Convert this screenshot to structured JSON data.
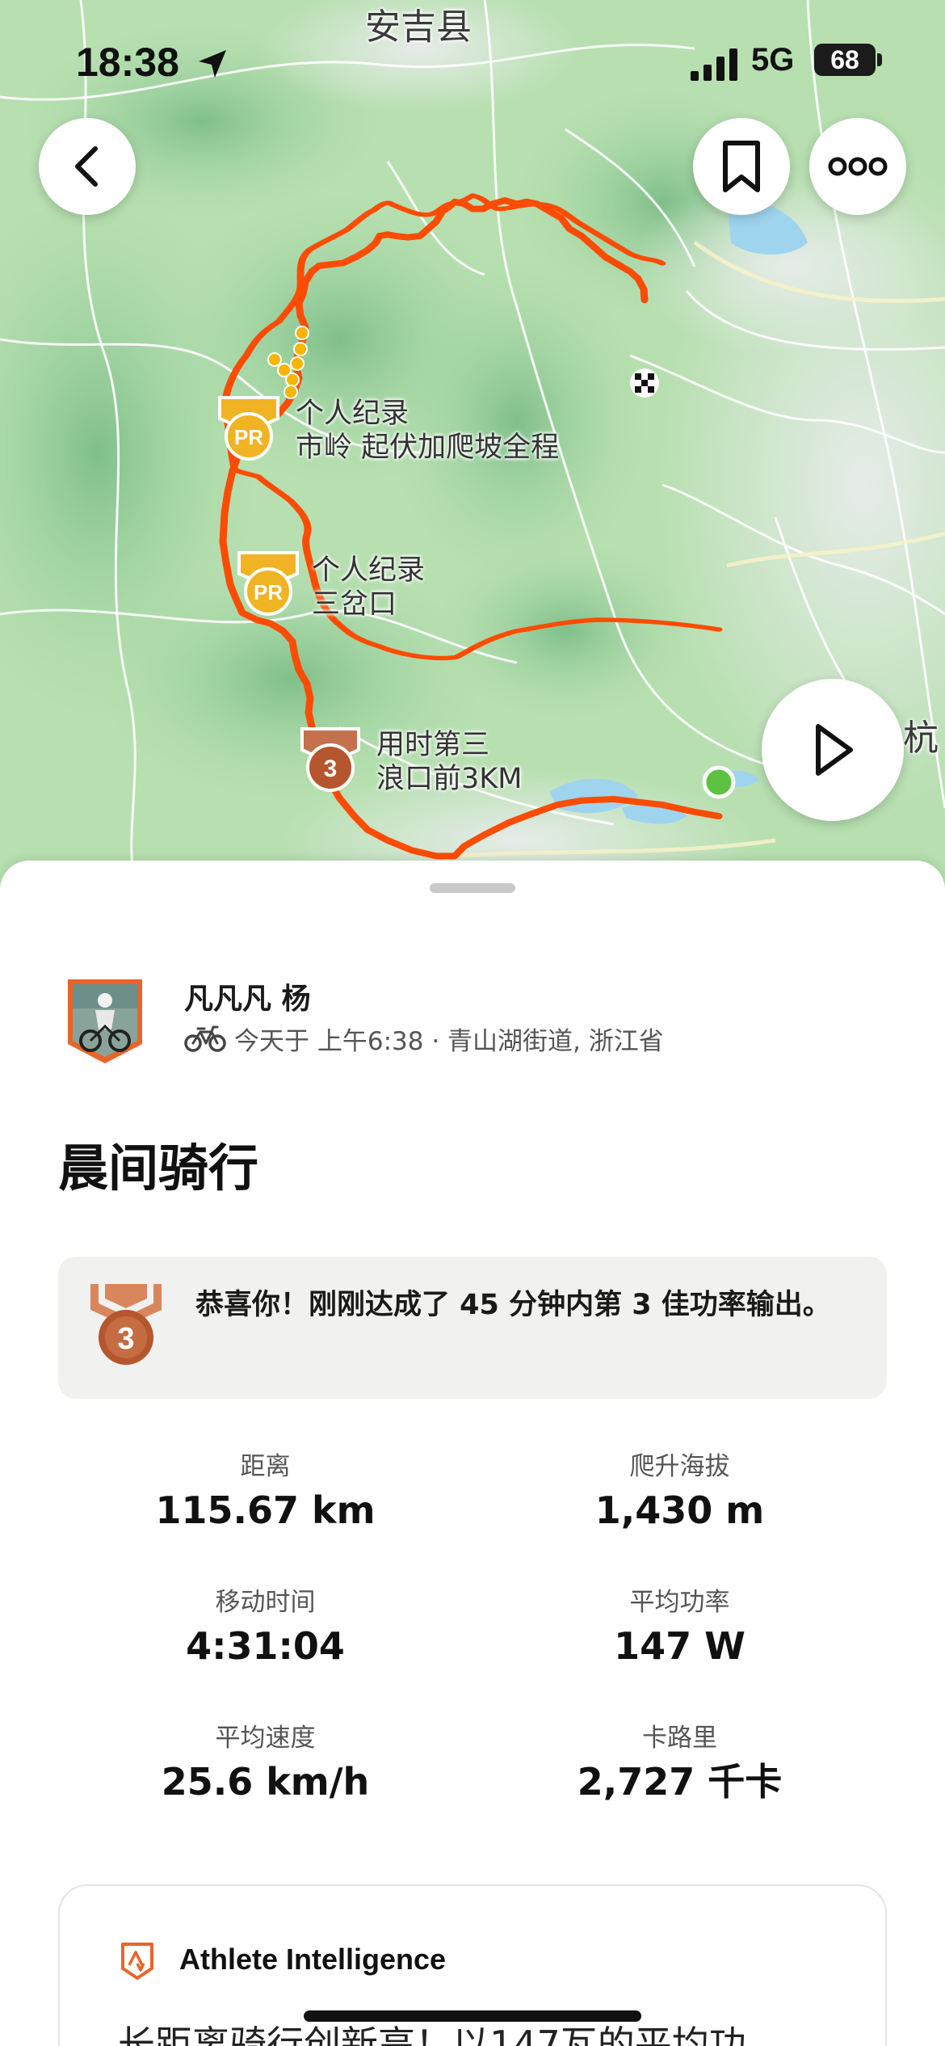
{
  "status_bar": {
    "time": "18:38",
    "network": "5G",
    "battery": "68"
  },
  "map": {
    "place_labels": {
      "county": "安吉县",
      "city_partial": "杭"
    },
    "segments": [
      {
        "badge": "PR",
        "line1": "个人纪录",
        "line2": "市岭 起伏加爬坡全程"
      },
      {
        "badge": "PR",
        "line1": "个人纪录",
        "line2": "三岔口"
      },
      {
        "badge": "3",
        "line1": "用时第三",
        "line2": "浪口前3KM"
      }
    ],
    "colors": {
      "route": "#fc4c02",
      "start": "#5cc23f",
      "pr_badge": "#f0b323",
      "bronze": "#b5562e"
    }
  },
  "athlete": {
    "name": "凡凡凡 杨",
    "meta": "今天于 上午6:38 · 青山湖街道, 浙江省",
    "activity_icon": "bike-icon"
  },
  "activity": {
    "title": "晨间骑行"
  },
  "achievement": {
    "text": "恭喜你！刚刚达成了 45 分钟内第 3 佳功率输出。",
    "medal": "3"
  },
  "stats": [
    {
      "label": "距离",
      "value": "115.67 km"
    },
    {
      "label": "爬升海拔",
      "value": "1,430 m"
    },
    {
      "label": "移动时间",
      "value": "4:31:04"
    },
    {
      "label": "平均功率",
      "value": "147 W"
    },
    {
      "label": "平均速度",
      "value": "25.6 km/h"
    },
    {
      "label": "卡路里",
      "value": "2,727 千卡"
    }
  ],
  "athlete_intelligence": {
    "title": "Athlete Intelligence",
    "body": "长距离骑行创新高！以147瓦的平均功"
  }
}
